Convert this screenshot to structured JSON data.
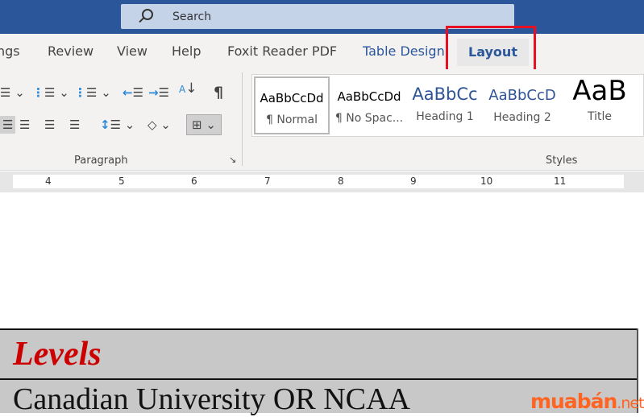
{
  "search": {
    "placeholder": "Search"
  },
  "tabs": [
    {
      "label": "ngs"
    },
    {
      "label": "Review"
    },
    {
      "label": "View"
    },
    {
      "label": "Help"
    },
    {
      "label": "Foxit Reader PDF"
    },
    {
      "label": "Table Design"
    },
    {
      "label": "Layout"
    }
  ],
  "ribbon": {
    "paragraph_label": "Paragraph",
    "styles_label": "Styles",
    "styles": [
      {
        "preview": "AaBbCcDd",
        "name": "¶ Normal"
      },
      {
        "preview": "AaBbCcDd",
        "name": "¶ No Spac..."
      },
      {
        "preview": "AaBbCc",
        "name": "Heading 1"
      },
      {
        "preview": "AaBbCcD",
        "name": "Heading 2"
      },
      {
        "preview": "AaB",
        "name": "Title"
      }
    ]
  },
  "ruler": [
    "4",
    "5",
    "6",
    "7",
    "8",
    "9",
    "10",
    "11"
  ],
  "document": {
    "row1": "Levels",
    "row2": "Canadian University OR NCAA"
  },
  "watermark": {
    "main": "muabán",
    "suffix": ".net"
  },
  "colors": {
    "titlebar": "#2b579a",
    "highlight": "#e81123",
    "heading_red": "#cc0000",
    "table_bg": "#c8c8c8"
  }
}
